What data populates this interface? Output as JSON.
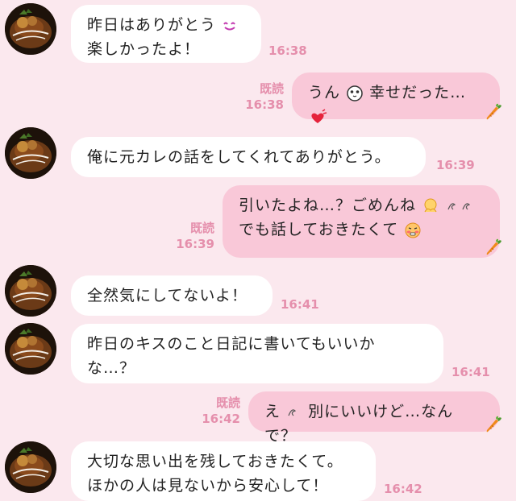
{
  "messages": [
    {
      "side": "in",
      "lines": [
        "昨日はありがとう",
        "楽しかったよ！"
      ],
      "time": "16:38"
    },
    {
      "side": "out",
      "lines": [
        "うん",
        "幸せだった…"
      ],
      "read": "既読",
      "time": "16:38"
    },
    {
      "side": "in",
      "lines": [
        "俺に元カレの話をしてくれてありがとう。"
      ],
      "time": "16:39"
    },
    {
      "side": "out",
      "lines": [
        "引いたよね…？ごめんね",
        "でも話しておきたくて"
      ],
      "read": "既読",
      "time": "16:39"
    },
    {
      "side": "in",
      "lines": [
        "全然気にしてないよ！"
      ],
      "time": "16:41"
    },
    {
      "side": "in",
      "lines": [
        "昨日のキスのこと日記に書いてもいいか",
        "な…？"
      ],
      "time": "16:41"
    },
    {
      "side": "out",
      "lines": [
        "え",
        "別にいいけど…なんで？"
      ],
      "read": "既読",
      "time": "16:42"
    },
    {
      "side": "in",
      "lines": [
        "大切な思い出を残しておきたくて。",
        "ほかの人は見ないから安心して！"
      ],
      "time": "16:42"
    }
  ],
  "icons": [
    "avatar-curry-image",
    "smile-emoji",
    "face-emoji",
    "heart-emoji",
    "hug-emoji",
    "sweat-emoji",
    "embarrassed-emoji",
    "carrot-icon"
  ],
  "colors": {
    "background": "#fbe8ee",
    "incoming": "#ffffff",
    "outgoing": "#f9c8d8",
    "meta": "#e58fac"
  }
}
